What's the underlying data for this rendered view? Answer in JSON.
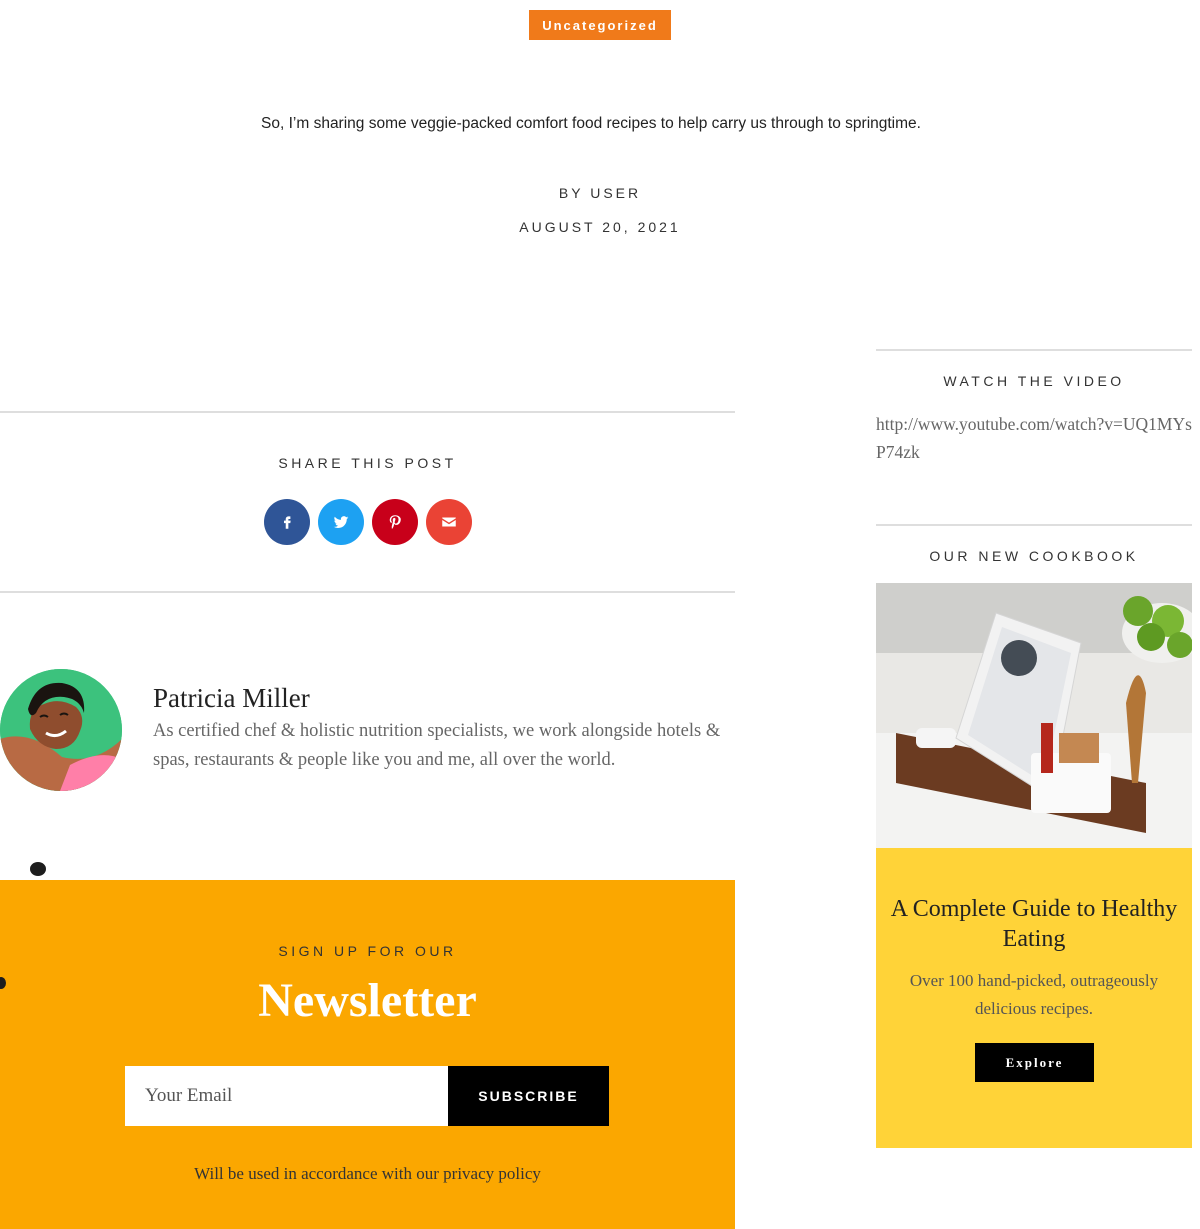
{
  "post": {
    "category": "Uncategorized",
    "excerpt": "So, I’m sharing some veggie-packed comfort food recipes to help carry us through to springtime.",
    "byline": "BY USER",
    "date": "AUGUST 20, 2021"
  },
  "share": {
    "title": "SHARE THIS POST",
    "buttons": [
      {
        "name": "facebook",
        "icon": "facebook-icon",
        "color": "#2f5597"
      },
      {
        "name": "twitter",
        "icon": "twitter-icon",
        "color": "#1da1f2"
      },
      {
        "name": "pinterest",
        "icon": "pinterest-icon",
        "color": "#c8001a"
      },
      {
        "name": "email",
        "icon": "envelope-icon",
        "color": "#ea4335"
      }
    ]
  },
  "author": {
    "name": "Patricia Miller",
    "bio": "As certified chef & holistic nutrition specialists, we work alongside hotels & spas, restaurants & people like you and me, all over the world."
  },
  "newsletter": {
    "subtitle": "SIGN UP FOR OUR",
    "title": "Newsletter",
    "email_placeholder": "Your Email",
    "button": "SUBSCRIBE",
    "privacy": "Will be used in accordance with our privacy policy",
    "bg_color": "#fba700"
  },
  "sidebar": {
    "video": {
      "title": "WATCH THE VIDEO",
      "link": "http://www.youtube.com/watch?v=UQ1MYsP74zk"
    },
    "cookbook": {
      "title": "OUR NEW COOKBOOK",
      "heading": "A Complete Guide to Healthy Eating",
      "description": "Over 100 hand-picked, outrageously delicious recipes.",
      "button": "Explore",
      "card_color": "#ffd338"
    }
  },
  "colors": {
    "accent_orange": "#f07a1a",
    "divider": "#dedede"
  }
}
